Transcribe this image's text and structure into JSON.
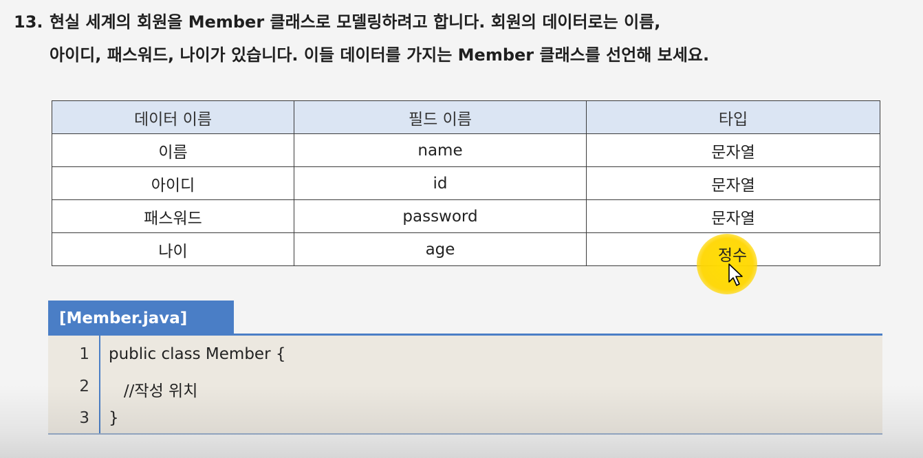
{
  "question": {
    "number": "13.",
    "line1": "현실 세계의 회원을 Member 클래스로 모델링하려고 합니다. 회원의 데이터로는 이름,",
    "line2": "아이디, 패스워드, 나이가 있습니다. 이들 데이터를 가지는 Member 클래스를 선언해 보세요."
  },
  "table": {
    "headers": [
      "데이터 이름",
      "필드 이름",
      "타입"
    ],
    "rows": [
      [
        "이름",
        "name",
        "문자열"
      ],
      [
        "아이디",
        "id",
        "문자열"
      ],
      [
        "패스워드",
        "password",
        "문자열"
      ],
      [
        "나이",
        "age",
        "정수"
      ]
    ]
  },
  "code": {
    "tab_label": "[Member.java]",
    "lines": [
      {
        "number": "1",
        "text": "public class Member {"
      },
      {
        "number": "2",
        "text": "   //작성 위치"
      },
      {
        "number": "3",
        "text": "}"
      }
    ]
  },
  "colors": {
    "tab": "#4a7ec6",
    "header_bg": "#dbe5f3",
    "code_bg": "#ece8e0",
    "highlight": "#ffdd00"
  },
  "icons": {
    "cursor": "mouse-pointer-icon",
    "highlight": "cursor-highlight-circle"
  }
}
